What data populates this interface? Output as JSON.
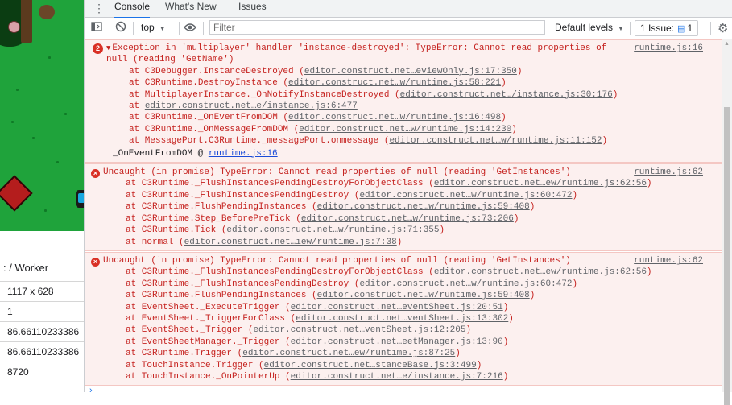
{
  "left_panel": {
    "header": ": / Worker",
    "rows": [
      "1117 x 628",
      "1",
      "86.66110233386",
      "86.66110233386",
      "8720"
    ]
  },
  "devtools": {
    "tabs": [
      {
        "label": "Console",
        "active": true
      },
      {
        "label": "What's New",
        "active": false
      },
      {
        "label": "Issues",
        "active": false
      }
    ],
    "toolbar": {
      "context": "top",
      "filter_placeholder": "Filter",
      "levels": "Default levels",
      "issues_label": "1 Issue:",
      "issues_count": "1"
    },
    "messages": [
      {
        "type": "error",
        "repeat_count": "2",
        "expanded": true,
        "text": "Exception in 'multiplayer' handler 'instance-destroyed': TypeError: Cannot read properties of\nnull (reading 'GetName')",
        "source": "runtime.js:16",
        "frames": [
          {
            "prefix": "at C3Debugger.InstanceDestroyed (",
            "link": "editor.construct.net…eviewOnly.js:17:350",
            "suffix": ")"
          },
          {
            "prefix": "at C3Runtime.DestroyInstance (",
            "link": "editor.construct.net…w/runtime.js:58:221",
            "suffix": ")"
          },
          {
            "prefix": "at MultiplayerInstance._OnNotifyInstanceDestroyed (",
            "link": "editor.construct.net…/instance.js:30:176",
            "suffix": ")"
          },
          {
            "prefix": "at ",
            "link": "editor.construct.net…e/instance.js:6:477",
            "suffix": ""
          },
          {
            "prefix": "at C3Runtime._OnEventFromDOM (",
            "link": "editor.construct.net…w/runtime.js:16:498",
            "suffix": ")"
          },
          {
            "prefix": "at C3Runtime._OnMessageFromDOM (",
            "link": "editor.construct.net…w/runtime.js:14:230",
            "suffix": ")"
          },
          {
            "prefix": "at MessagePort.C3Runtime._messagePort.onmessage (",
            "link": "editor.construct.net…w/runtime.js:11:152",
            "suffix": ")"
          }
        ],
        "async_label": "_OnEventFromDOM @ ",
        "async_link": "runtime.js:16"
      },
      {
        "type": "error",
        "text": "Uncaught (in promise) TypeError: Cannot read properties of null (reading 'GetInstances')",
        "source": "runtime.js:62",
        "frames": [
          {
            "prefix": "at C3Runtime._FlushInstancesPendingDestroyForObjectClass (",
            "link": "editor.construct.net…ew/runtime.js:62:56",
            "suffix": ")"
          },
          {
            "prefix": "at C3Runtime._FlushInstancesPendingDestroy (",
            "link": "editor.construct.net…w/runtime.js:60:472",
            "suffix": ")"
          },
          {
            "prefix": "at C3Runtime.FlushPendingInstances (",
            "link": "editor.construct.net…w/runtime.js:59:408",
            "suffix": ")"
          },
          {
            "prefix": "at C3Runtime.Step_BeforePreTick (",
            "link": "editor.construct.net…w/runtime.js:73:206",
            "suffix": ")"
          },
          {
            "prefix": "at C3Runtime.Tick (",
            "link": "editor.construct.net…w/runtime.js:71:355",
            "suffix": ")"
          },
          {
            "prefix": "at normal (",
            "link": "editor.construct.net…iew/runtime.js:7:38",
            "suffix": ")"
          }
        ]
      },
      {
        "type": "error",
        "text": "Uncaught (in promise) TypeError: Cannot read properties of null (reading 'GetInstances')",
        "source": "runtime.js:62",
        "frames": [
          {
            "prefix": "at C3Runtime._FlushInstancesPendingDestroyForObjectClass (",
            "link": "editor.construct.net…ew/runtime.js:62:56",
            "suffix": ")"
          },
          {
            "prefix": "at C3Runtime._FlushInstancesPendingDestroy (",
            "link": "editor.construct.net…w/runtime.js:60:472",
            "suffix": ")"
          },
          {
            "prefix": "at C3Runtime.FlushPendingInstances (",
            "link": "editor.construct.net…w/runtime.js:59:408",
            "suffix": ")"
          },
          {
            "prefix": "at EventSheet._ExecuteTrigger (",
            "link": "editor.construct.net…eventSheet.js:20:51",
            "suffix": ")"
          },
          {
            "prefix": "at EventSheet._TriggerForClass (",
            "link": "editor.construct.net…ventSheet.js:13:302",
            "suffix": ")"
          },
          {
            "prefix": "at EventSheet._Trigger (",
            "link": "editor.construct.net…ventSheet.js:12:205",
            "suffix": ")"
          },
          {
            "prefix": "at EventSheetManager._Trigger (",
            "link": "editor.construct.net…eetManager.js:13:90",
            "suffix": ")"
          },
          {
            "prefix": "at C3Runtime.Trigger (",
            "link": "editor.construct.net…ew/runtime.js:87:25",
            "suffix": ")"
          },
          {
            "prefix": "at TouchInstance.Trigger (",
            "link": "editor.construct.net…stanceBase.js:3:499",
            "suffix": ")"
          },
          {
            "prefix": "at TouchInstance._OnPointerUp (",
            "link": "editor.construct.net…e/instance.js:7:216",
            "suffix": ")"
          }
        ]
      }
    ]
  }
}
